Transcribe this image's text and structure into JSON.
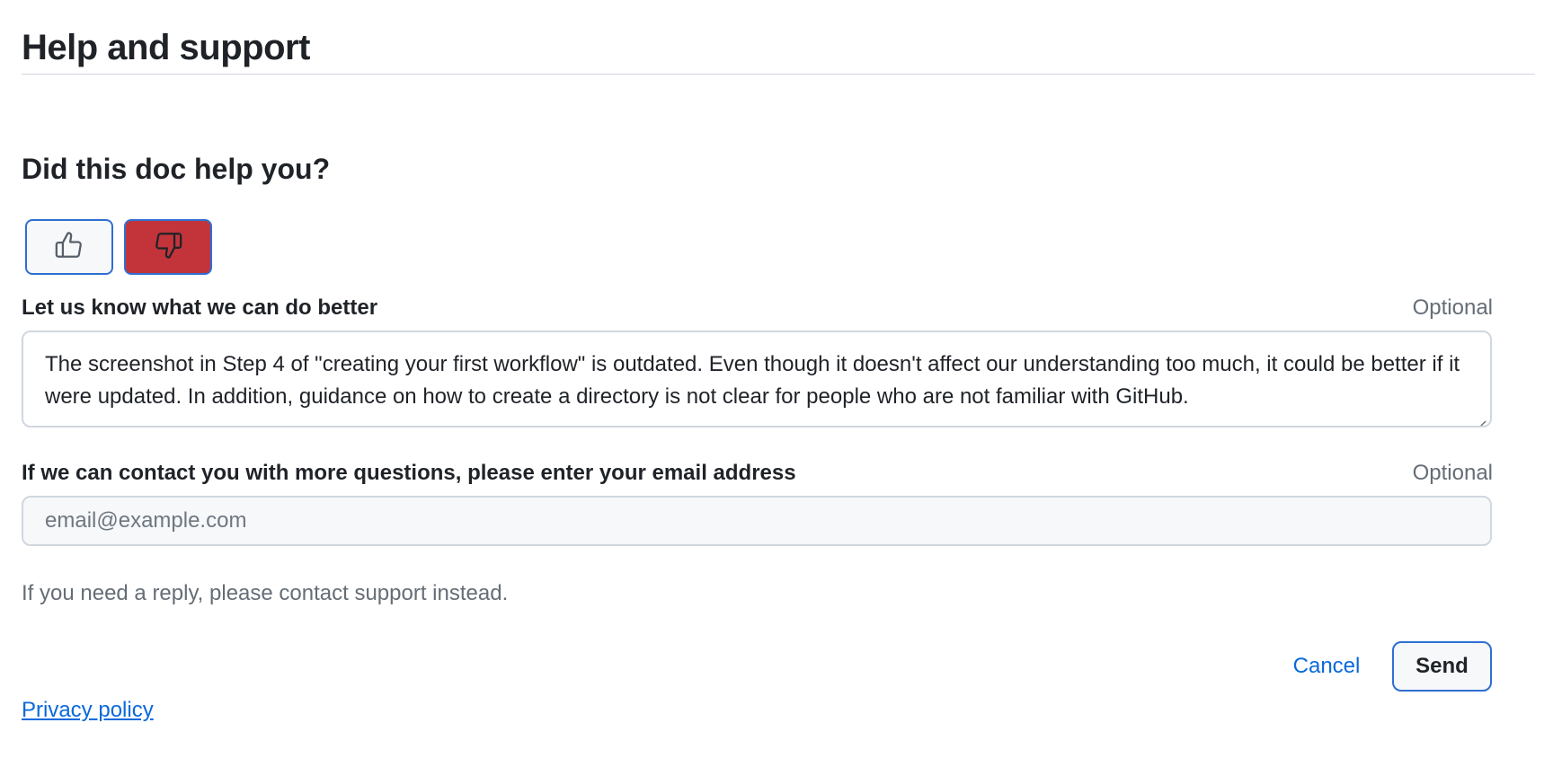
{
  "page": {
    "title": "Help and support"
  },
  "feedback": {
    "question": "Did this doc help you?",
    "thumbs_up_icon": "thumbs-up-icon",
    "thumbs_down_icon": "thumbs-down-icon",
    "selected_vote": "no",
    "selected_color": "#c3343a",
    "comment": {
      "label": "Let us know what we can do better",
      "optional": "Optional",
      "value": "The screenshot in Step 4 of \"creating your first workflow\" is outdated. Even though it doesn't affect our understanding too much, it could be better if it were updated. In addition, guidance on how to create a directory is not clear for people who are not familiar with GitHub."
    },
    "email": {
      "label": "If we can contact you with more questions, please enter your email address",
      "optional": "Optional",
      "placeholder": "email@example.com",
      "value": ""
    },
    "helper": "If you need a reply, please contact support instead.",
    "cancel_label": "Cancel",
    "send_label": "Send",
    "privacy_label": "Privacy policy"
  },
  "colors": {
    "link": "#0969da",
    "focus_border": "#2f6fd1",
    "muted_text": "#656d76"
  }
}
